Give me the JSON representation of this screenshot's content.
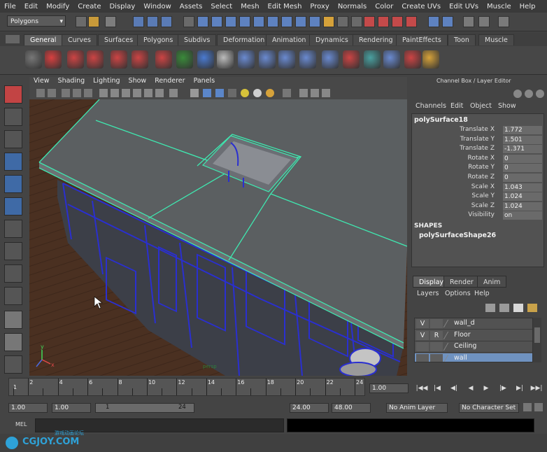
{
  "menubar": [
    "File",
    "Edit",
    "Modify",
    "Create",
    "Display",
    "Window",
    "Assets",
    "Select",
    "Mesh",
    "Edit Mesh",
    "Proxy",
    "Normals",
    "Color",
    "Create UVs",
    "Edit UVs",
    "Muscle",
    "Help"
  ],
  "statusline": {
    "mode": "Polygons"
  },
  "shelf": {
    "tabs": [
      "General",
      "Curves",
      "Surfaces",
      "Polygons",
      "Subdivs",
      "Deformation",
      "Animation",
      "Dynamics",
      "Rendering",
      "PaintEffects",
      "Toon",
      "Muscle"
    ],
    "active_tab": "General"
  },
  "viewport": {
    "menu": [
      "View",
      "Shading",
      "Lighting",
      "Show",
      "Renderer",
      "Panels"
    ],
    "camera_label": "persp",
    "axis_labels": {
      "y": "y",
      "x": "x"
    }
  },
  "channel_box": {
    "title": "Channel Box / Layer Editor",
    "menu": [
      "Channels",
      "Edit",
      "Object",
      "Show"
    ],
    "object_name": "polySurface18",
    "attributes": [
      {
        "name": "Translate X",
        "value": "1.772"
      },
      {
        "name": "Translate Y",
        "value": "1.501"
      },
      {
        "name": "Translate Z",
        "value": "-1.371"
      },
      {
        "name": "Rotate X",
        "value": "0"
      },
      {
        "name": "Rotate Y",
        "value": "0"
      },
      {
        "name": "Rotate Z",
        "value": "0"
      },
      {
        "name": "Scale X",
        "value": "1.043"
      },
      {
        "name": "Scale Y",
        "value": "1.024"
      },
      {
        "name": "Scale Z",
        "value": "1.024"
      },
      {
        "name": "Visibility",
        "value": "on"
      }
    ],
    "shapes_header": "SHAPES",
    "shape_name": "polySurfaceShape26"
  },
  "layer_editor": {
    "tabs": [
      "Display",
      "Render",
      "Anim"
    ],
    "active_tab": "Display",
    "menu": [
      "Layers",
      "Options",
      "Help"
    ],
    "layers": [
      {
        "v": "V",
        "r": "",
        "name": "wall_d",
        "selected": false
      },
      {
        "v": "V",
        "r": "R",
        "name": "Floor",
        "selected": false
      },
      {
        "v": "",
        "r": "",
        "name": "Ceiling",
        "selected": false
      },
      {
        "v": "",
        "r": "",
        "name": "wall",
        "selected": true
      }
    ]
  },
  "time_slider": {
    "ticks": [
      "2",
      "4",
      "6",
      "8",
      "10",
      "12",
      "14",
      "16",
      "18",
      "20",
      "22",
      "24"
    ],
    "start_frame_label": "1",
    "current_frame": "1.00"
  },
  "range": {
    "start": "1.00",
    "playback_start": "1.00",
    "range_start_label": "1",
    "range_end_label": "24",
    "playback_end": "24.00",
    "end": "48.00",
    "anim_layer": "No Anim Layer",
    "character_set": "No Character Set"
  },
  "command_line": {
    "label": "MEL",
    "watermark": "CGJOY.COM",
    "watermark_sub": "游戏动画论坛"
  },
  "colors": {
    "accent": "#6f92c0",
    "wire": "#2a2fd0",
    "selection": "#3fe8b0",
    "floor": "#4a3021"
  }
}
